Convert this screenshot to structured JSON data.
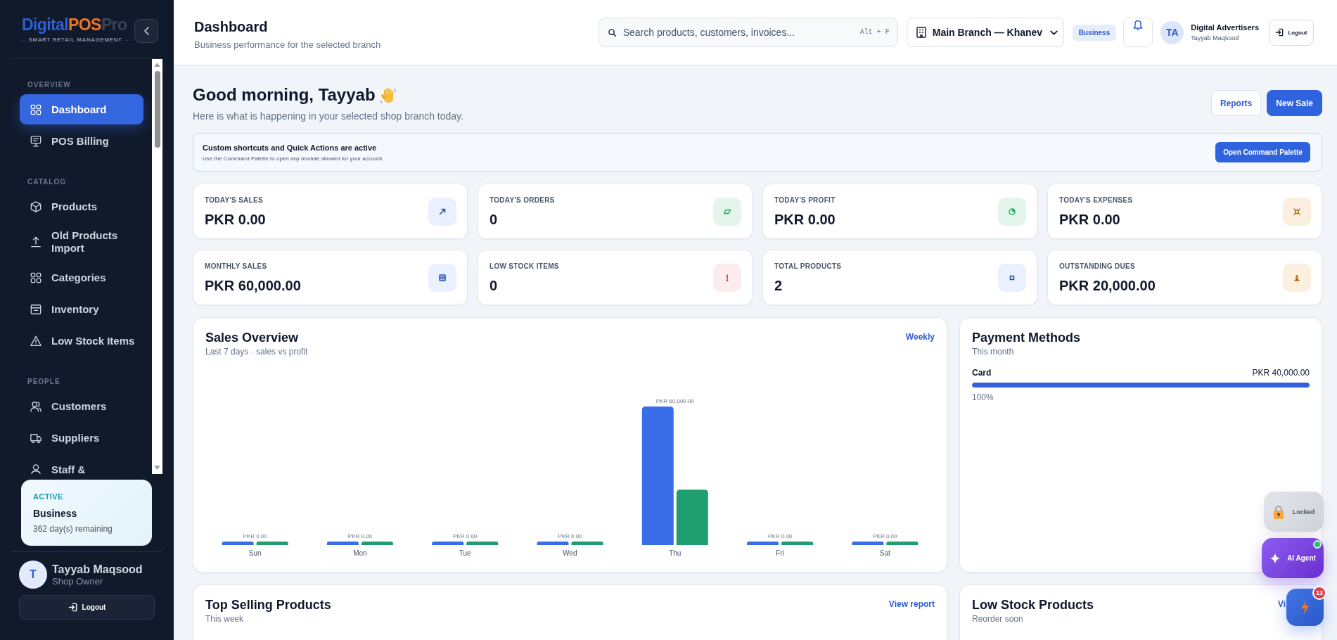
{
  "sidebar": {
    "logo": {
      "part_1": "Digital",
      "part_2": "POS",
      "part_3": "Pro",
      "tagline": "SMART RETAIL MANAGEMENT"
    },
    "sections": [
      {
        "title": "OVERVIEW",
        "items": [
          {
            "label": "Dashboard",
            "selected": true
          },
          {
            "label": "POS Billing",
            "selected": false
          }
        ]
      },
      {
        "title": "CATALOG",
        "items": [
          {
            "label": "Products",
            "selected": false
          },
          {
            "label": "Old Products Import",
            "selected": false
          },
          {
            "label": "Categories",
            "selected": false
          },
          {
            "label": "Inventory",
            "selected": false
          },
          {
            "label": "Low Stock Items",
            "selected": false
          }
        ]
      },
      {
        "title": "PEOPLE",
        "items": [
          {
            "label": "Customers",
            "selected": false
          },
          {
            "label": "Suppliers",
            "selected": false
          },
          {
            "label": "Staff &",
            "selected": false
          }
        ]
      }
    ],
    "plan": {
      "status": "ACTIVE",
      "name": "Business",
      "remaining": "362 day(s) remaining"
    },
    "user": {
      "initial": "T",
      "name": "Tayyab Maqsood",
      "role": "Shop Owner"
    },
    "logout": "Logout"
  },
  "header": {
    "title": "Dashboard",
    "subtitle": "Business performance for the selected branch",
    "search": {
      "placeholder": "Search products, customers, invoices...",
      "shortcut": "Alt + F"
    },
    "branch": "Main Branch — Khanev",
    "plan_badge": "Business",
    "user": {
      "initials": "TA",
      "name": "Digital Advertisers",
      "subtitle": "Tayyab Maqsood"
    },
    "logout": "Logout"
  },
  "greeting": {
    "title": "Good morning, Tayyab",
    "subtitle": "Here is what is happening in your selected shop branch today.",
    "actions": [
      {
        "label": "Reports",
        "kind": "secondary"
      },
      {
        "label": "New Sale",
        "kind": "primary"
      }
    ]
  },
  "banner": {
    "title": "Custom shortcuts and Quick Actions are active",
    "text": "Use the Command Palette to open any module allowed for your account.",
    "button": "Open Command Palette"
  },
  "stats": [
    {
      "label": "TODAY'S SALES",
      "value": "PKR 0.00",
      "color": "#eaf0fd"
    },
    {
      "label": "TODAY'S ORDERS",
      "value": "0",
      "color": "#e4f5ec"
    },
    {
      "label": "TODAY'S PROFIT",
      "value": "PKR 0.00",
      "color": "#e4f5ec"
    },
    {
      "label": "TODAY'S EXPENSES",
      "value": "PKR 0.00",
      "color": "#fbefdf"
    },
    {
      "label": "MONTHLY SALES",
      "value": "PKR 60,000.00",
      "color": "#eaf0fd"
    },
    {
      "label": "LOW STOCK ITEMS",
      "value": "0",
      "color": "#fdecee"
    },
    {
      "label": "TOTAL PRODUCTS",
      "value": "2",
      "color": "#eaf0fd"
    },
    {
      "label": "OUTSTANDING DUES",
      "value": "PKR 20,000.00",
      "color": "#fbefdf"
    }
  ],
  "sales_overview": {
    "title": "Sales Overview",
    "subtitle": "Last 7 days · sales vs profit",
    "link": "Weekly",
    "chart_data": {
      "type": "bar",
      "categories": [
        "Sun",
        "Mon",
        "Tue",
        "Wed",
        "Thu",
        "Fri",
        "Sat"
      ],
      "series": [
        {
          "color": "#3a6ee8",
          "values": [
            0,
            0,
            0,
            0,
            60000,
            0,
            0
          ],
          "value_labels": [
            "PKR 0.00",
            "PKR 0.00",
            "PKR 0.00",
            "PKR 0.00",
            "PKR 60,000.00",
            "PKR 0.00",
            "PKR 0.00"
          ]
        },
        {
          "color": "#1f9e70",
          "values": [
            0,
            0,
            0,
            0,
            24000,
            0,
            0
          ]
        }
      ]
    }
  },
  "payment_methods": {
    "title": "Payment Methods",
    "subtitle": "This month",
    "methods": [
      {
        "name": "Card",
        "amount": "PKR 40,000.00",
        "level": 1,
        "share": "100%"
      }
    ]
  },
  "top_selling": {
    "title": "Top Selling Products",
    "subtitle": "This week",
    "link": "View report"
  },
  "low_stock": {
    "title": "Low Stock Products",
    "subtitle": "Reorder soon",
    "link": "Vi"
  },
  "floating": {
    "locked": "Locked",
    "ai_agent": "AI Agent",
    "ai_online": true,
    "badge": "13"
  }
}
